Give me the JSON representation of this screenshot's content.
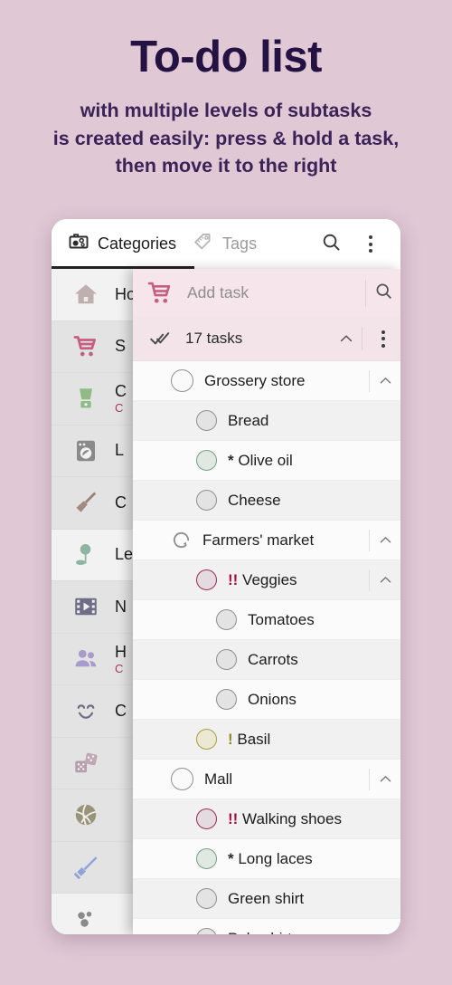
{
  "promo": {
    "title": "To-do list",
    "subtitle": "with multiple levels of subtasks\nis created easily: press & hold a task,\nthen move it to the right"
  },
  "colors": {
    "background": "#e0c8d5",
    "promo_text": "#231242",
    "accent_pink": "#c4607f",
    "panel_header": "#f6e6ec",
    "priority_high": "#a3123e",
    "priority_medium": "#8f8c1f",
    "priority_low": "#2c2c2c"
  },
  "app": {
    "tabs": [
      {
        "label": "Categories",
        "icon": "categories-icon",
        "active": true
      },
      {
        "label": "Tags",
        "icon": "tag-icon",
        "active": false
      }
    ],
    "actions": [
      {
        "name": "search-icon",
        "label": "Search"
      },
      {
        "name": "overflow-menu-icon",
        "label": "More options"
      }
    ]
  },
  "sidebar": {
    "items": [
      {
        "label": "Home",
        "icon": "house-icon",
        "sub": ""
      },
      {
        "label": "S",
        "icon": "shopping-cart-icon",
        "sub": ""
      },
      {
        "label": "C",
        "icon": "blender-icon",
        "sub": "C"
      },
      {
        "label": "L",
        "icon": "washing-machine-icon",
        "sub": ""
      },
      {
        "label": "C",
        "icon": "broom-icon",
        "sub": ""
      },
      {
        "label": "Lei",
        "icon": "tree-icon",
        "sub": ""
      },
      {
        "label": "N",
        "icon": "film-icon",
        "sub": ""
      },
      {
        "label": "H",
        "icon": "people-icon",
        "sub": "C"
      },
      {
        "label": "C",
        "icon": "smiley-icon",
        "sub": ""
      },
      {
        "label": "",
        "icon": "dice-icon",
        "sub": ""
      },
      {
        "label": "",
        "icon": "volleyball-icon",
        "sub": ""
      },
      {
        "label": "",
        "icon": "sword-icon",
        "sub": ""
      },
      {
        "label": "",
        "icon": "balls-icon",
        "sub": ""
      }
    ]
  },
  "panel": {
    "add_task_placeholder": "Add task",
    "add_task_icon": "shopping-cart-icon",
    "search_icon": "search-icon",
    "counter_label": "17 tasks",
    "counter_icon": "double-check-icon",
    "collapse_icon": "chevron-up-icon",
    "overflow_icon": "overflow-menu-icon",
    "tasks": [
      {
        "label": "Grossery store",
        "mark": "",
        "priority": "none",
        "indent": 0,
        "circle": "grey-lg",
        "collapsible": true,
        "leading_icon": "checkbox-circle"
      },
      {
        "label": "Bread",
        "mark": "",
        "priority": "none",
        "indent": 1,
        "circle": "grey",
        "collapsible": false,
        "leading_icon": "checkbox-circle"
      },
      {
        "label": "Olive oil",
        "mark": "*",
        "priority": "low",
        "indent": 1,
        "circle": "green",
        "collapsible": false,
        "leading_icon": "checkbox-circle"
      },
      {
        "label": "Cheese",
        "mark": "",
        "priority": "none",
        "indent": 1,
        "circle": "grey",
        "collapsible": false,
        "leading_icon": "checkbox-circle"
      },
      {
        "label": "Farmers' market",
        "mark": "",
        "priority": "none",
        "indent": 0,
        "circle": "repeat",
        "collapsible": true,
        "leading_icon": "recurring-icon"
      },
      {
        "label": "Veggies",
        "mark": "!!",
        "priority": "high",
        "indent": 1,
        "circle": "pink",
        "collapsible": true,
        "leading_icon": "checkbox-circle"
      },
      {
        "label": "Tomatoes",
        "mark": "",
        "priority": "none",
        "indent": 2,
        "circle": "grey",
        "collapsible": false,
        "leading_icon": "checkbox-circle"
      },
      {
        "label": "Carrots",
        "mark": "",
        "priority": "none",
        "indent": 2,
        "circle": "grey",
        "collapsible": false,
        "leading_icon": "checkbox-circle"
      },
      {
        "label": "Onions",
        "mark": "",
        "priority": "none",
        "indent": 2,
        "circle": "grey",
        "collapsible": false,
        "leading_icon": "checkbox-circle"
      },
      {
        "label": "Basil",
        "mark": "!",
        "priority": "medium",
        "indent": 1,
        "circle": "yellow",
        "collapsible": false,
        "leading_icon": "checkbox-circle"
      },
      {
        "label": "Mall",
        "mark": "",
        "priority": "none",
        "indent": 0,
        "circle": "grey-lg",
        "collapsible": true,
        "leading_icon": "checkbox-circle"
      },
      {
        "label": "Walking shoes",
        "mark": "!!",
        "priority": "high",
        "indent": 1,
        "circle": "pink",
        "collapsible": false,
        "leading_icon": "checkbox-circle"
      },
      {
        "label": "Long laces",
        "mark": "*",
        "priority": "low",
        "indent": 1,
        "circle": "green",
        "collapsible": false,
        "leading_icon": "checkbox-circle"
      },
      {
        "label": "Green shirt",
        "mark": "",
        "priority": "none",
        "indent": 1,
        "circle": "grey",
        "collapsible": false,
        "leading_icon": "checkbox-circle"
      },
      {
        "label": "Polo shirt",
        "mark": "",
        "priority": "none",
        "indent": 1,
        "circle": "grey",
        "collapsible": false,
        "leading_icon": "checkbox-circle"
      }
    ]
  }
}
